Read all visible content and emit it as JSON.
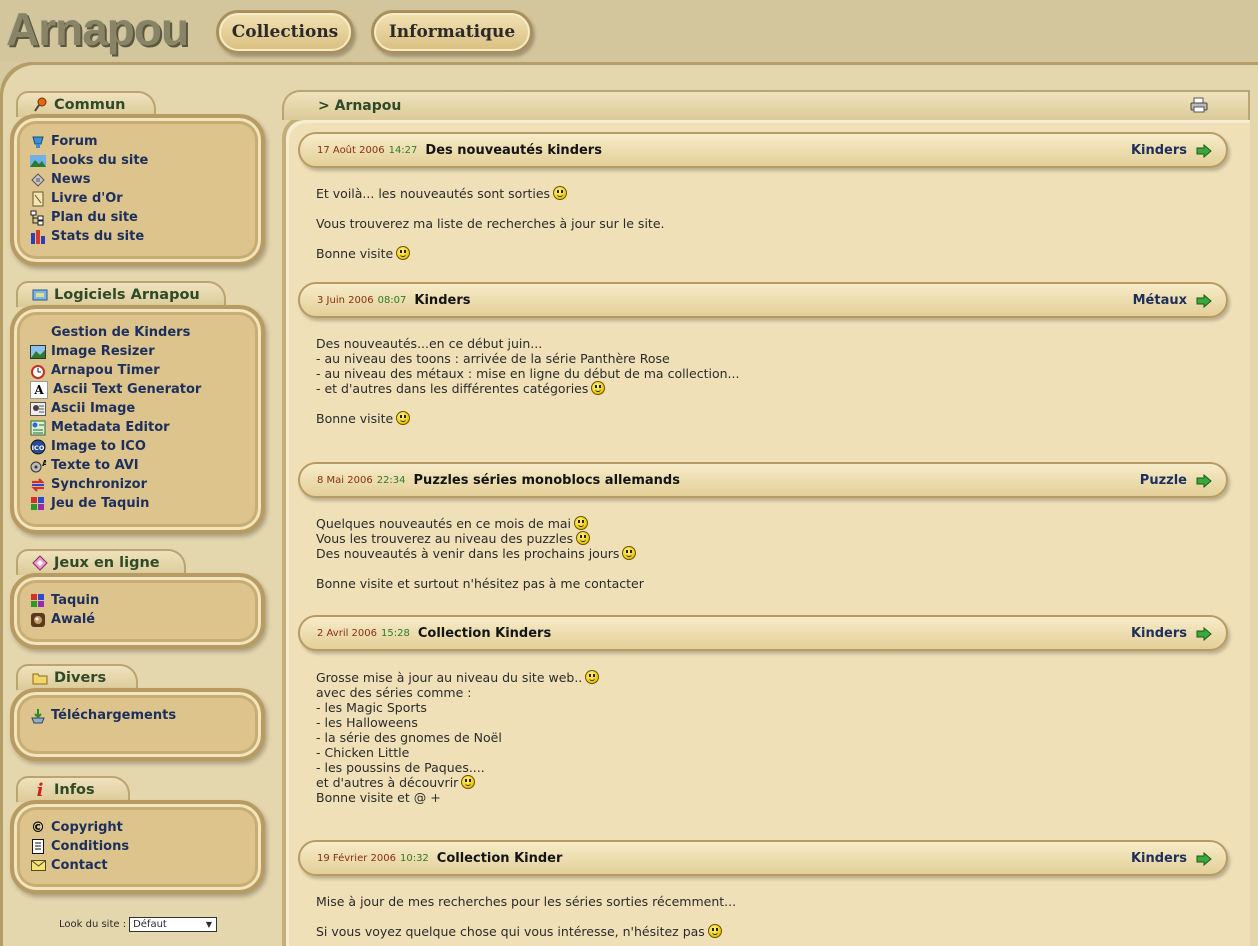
{
  "header": {
    "logo": "Arnapou",
    "nav": [
      {
        "label": "Collections"
      },
      {
        "label": "Informatique"
      }
    ]
  },
  "sidebar": {
    "sections": [
      {
        "title": "Commun",
        "icon": "pin-icon",
        "items": [
          {
            "label": "Forum",
            "icon": "forum-icon"
          },
          {
            "label": "Looks du site",
            "icon": "landscape-icon"
          },
          {
            "label": "News",
            "icon": "news-icon"
          },
          {
            "label": "Livre d'Or",
            "icon": "guestbook-icon"
          },
          {
            "label": "Plan du site",
            "icon": "sitemap-icon"
          },
          {
            "label": "Stats du site",
            "icon": "stats-icon"
          }
        ]
      },
      {
        "title": "Logiciels Arnapou",
        "icon": "software-icon",
        "items": [
          {
            "label": "Gestion de Kinders",
            "icon": ""
          },
          {
            "label": "Image Resizer",
            "icon": "image-icon"
          },
          {
            "label": "Arnapou Timer",
            "icon": "timer-icon"
          },
          {
            "label": "Ascii Text Generator",
            "icon": "letter-a-icon"
          },
          {
            "label": "Ascii Image",
            "icon": "ascii-image-icon"
          },
          {
            "label": "Metadata Editor",
            "icon": "metadata-icon"
          },
          {
            "label": "Image to ICO",
            "icon": "ico-icon"
          },
          {
            "label": "Texte to AVI",
            "icon": "film-icon"
          },
          {
            "label": "Synchronizor",
            "icon": "sync-icon"
          },
          {
            "label": "Jeu de Taquin",
            "icon": "puzzle-icon"
          }
        ]
      },
      {
        "title": "Jeux en ligne",
        "icon": "diamond-icon",
        "items": [
          {
            "label": "Taquin",
            "icon": "puzzle-icon"
          },
          {
            "label": "Awalé",
            "icon": "awale-icon"
          }
        ]
      },
      {
        "title": "Divers",
        "icon": "folder-icon",
        "items": [
          {
            "label": "Téléchargements",
            "icon": "download-icon"
          }
        ]
      },
      {
        "title": "Infos",
        "icon": "info-icon",
        "items": [
          {
            "label": "Copyright",
            "icon": "copyright-icon"
          },
          {
            "label": "Conditions",
            "icon": "document-icon"
          },
          {
            "label": "Contact",
            "icon": "envelope-icon"
          }
        ]
      }
    ],
    "look": {
      "label": "Look du site :",
      "value": "Défaut"
    }
  },
  "main": {
    "breadcrumb": "> Arnapou",
    "news": [
      {
        "date": "17 Août 2006",
        "time": "14:27",
        "title": "Des nouveautés kinders",
        "category": "Kinders",
        "lines": [
          {
            "text": "Et voilà... les nouveautés sont sorties",
            "smiley": true
          },
          {
            "text": "",
            "smiley": false
          },
          {
            "text": "Vous trouverez ma liste de recherches à jour sur le site.",
            "smiley": false
          },
          {
            "text": "",
            "smiley": false
          },
          {
            "text": "Bonne visite",
            "smiley": true
          }
        ]
      },
      {
        "date": "3 Juin 2006",
        "time": "08:07",
        "title": "Kinders",
        "category": "Métaux",
        "lines": [
          {
            "text": "Des nouveautés...en ce début juin...",
            "smiley": false
          },
          {
            "text": "- au niveau des toons : arrivée de la série Panthère Rose",
            "smiley": false
          },
          {
            "text": "- au niveau des métaux : mise en ligne du début de ma collection...",
            "smiley": false
          },
          {
            "text": "- et d'autres dans les différentes catégories",
            "smiley": true
          },
          {
            "text": "",
            "smiley": false
          },
          {
            "text": "Bonne visite",
            "smiley": true
          }
        ]
      },
      {
        "date": "8 Mai 2006",
        "time": "22:34",
        "title": "Puzzles séries monoblocs allemands",
        "category": "Puzzle",
        "lines": [
          {
            "text": "Quelques nouveautés en ce mois de mai",
            "smiley": true
          },
          {
            "text": "Vous les trouverez au niveau des puzzles",
            "smiley": true
          },
          {
            "text": "Des nouveautés à venir dans les prochains jours",
            "smiley": true
          },
          {
            "text": "",
            "smiley": false
          },
          {
            "text": "Bonne visite et surtout n'hésitez pas à me contacter",
            "smiley": false
          }
        ]
      },
      {
        "date": "2 Avril 2006",
        "time": "15:28",
        "title": "Collection Kinders",
        "category": "Kinders",
        "lines": [
          {
            "text": "Grosse mise à jour au niveau du site web..",
            "smiley": true
          },
          {
            "text": "avec des séries comme :",
            "smiley": false
          },
          {
            "text": "- les Magic Sports",
            "smiley": false
          },
          {
            "text": "- les Halloweens",
            "smiley": false
          },
          {
            "text": "- la série des gnomes de Noël",
            "smiley": false
          },
          {
            "text": "- Chicken Little",
            "smiley": false
          },
          {
            "text": "- les poussins de Paques....",
            "smiley": false
          },
          {
            "text": "et d'autres à découvrir",
            "smiley": true
          },
          {
            "text": "Bonne visite et @ +",
            "smiley": false
          }
        ]
      },
      {
        "date": "19 Février 2006",
        "time": "10:32",
        "title": "Collection Kinder",
        "category": "Kinders",
        "lines": [
          {
            "text": "Mise à jour de mes recherches pour les séries sorties récemment...",
            "smiley": false
          },
          {
            "text": "",
            "smiley": false
          },
          {
            "text": "Si vous voyez quelque chose qui vous intéresse, n'hésitez pas",
            "smiley": true
          }
        ]
      }
    ]
  }
}
